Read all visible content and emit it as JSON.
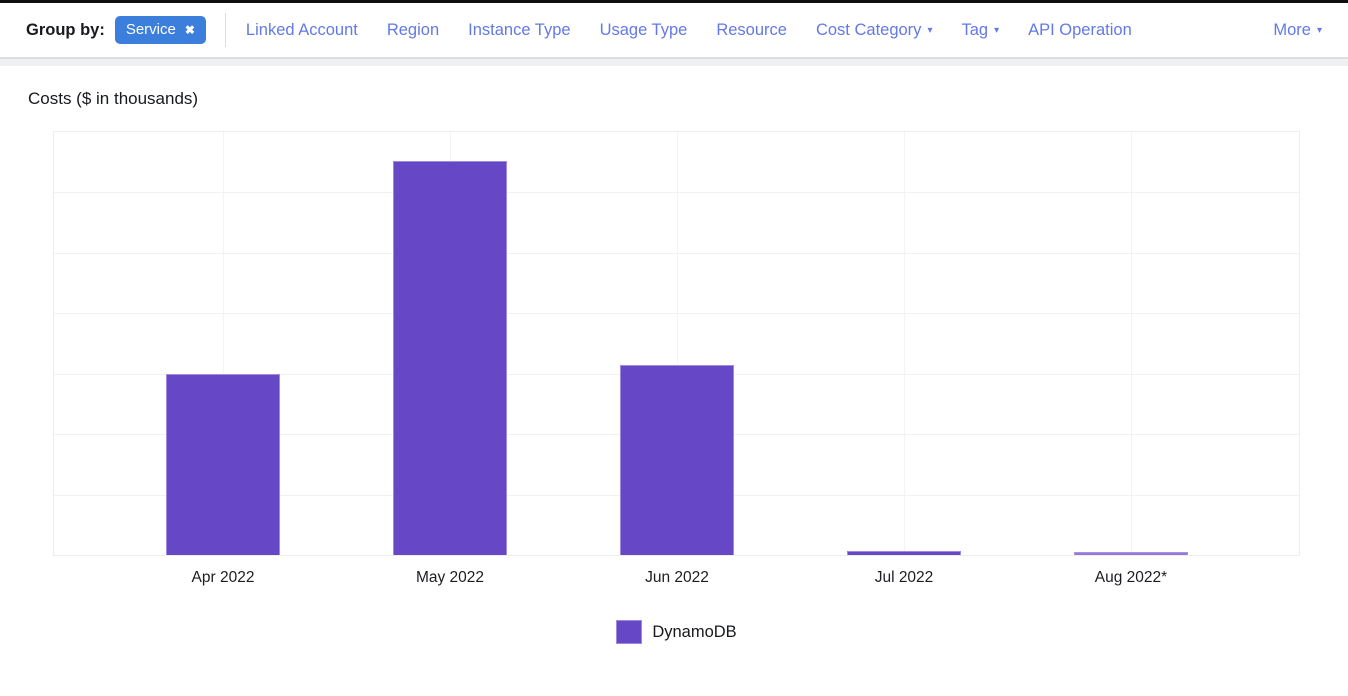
{
  "toolbar": {
    "group_by_label": "Group by:",
    "chip": {
      "label": "Service",
      "remove_glyph": "✖"
    },
    "caret_glyph": "▾",
    "links": [
      {
        "label": "Linked Account",
        "has_caret": false
      },
      {
        "label": "Region",
        "has_caret": false
      },
      {
        "label": "Instance Type",
        "has_caret": false
      },
      {
        "label": "Usage Type",
        "has_caret": false
      },
      {
        "label": "Resource",
        "has_caret": false
      },
      {
        "label": "Cost Category",
        "has_caret": true
      },
      {
        "label": "Tag",
        "has_caret": true
      },
      {
        "label": "API Operation",
        "has_caret": false
      }
    ],
    "more_link": {
      "label": "More",
      "has_caret": true
    }
  },
  "chart_data": {
    "type": "bar",
    "title": "Costs ($ in thousands)",
    "categories": [
      "Apr 2022",
      "May 2022",
      "Jun 2022",
      "Jul 2022",
      "Aug 2022*"
    ],
    "series": [
      {
        "name": "DynamoDB",
        "values": [
          30,
          65.2,
          31.5,
          0.7,
          0.5
        ]
      }
    ],
    "forecast_categories": [
      "Aug 2022*"
    ],
    "xlabel": "",
    "ylabel": "",
    "ylim": [
      0,
      70
    ],
    "gridline_interval": 10,
    "y_ticks_labeled": false,
    "grid": true,
    "legend_position": "bottom"
  },
  "colors": {
    "bar": "#6648c6",
    "bar_forecast": "#9479d9",
    "link": "#6379e6",
    "chip_bg": "#3c7edb",
    "chip_text": "#ffffff",
    "gridline": "#f2f2f2",
    "text": "#17191c"
  }
}
